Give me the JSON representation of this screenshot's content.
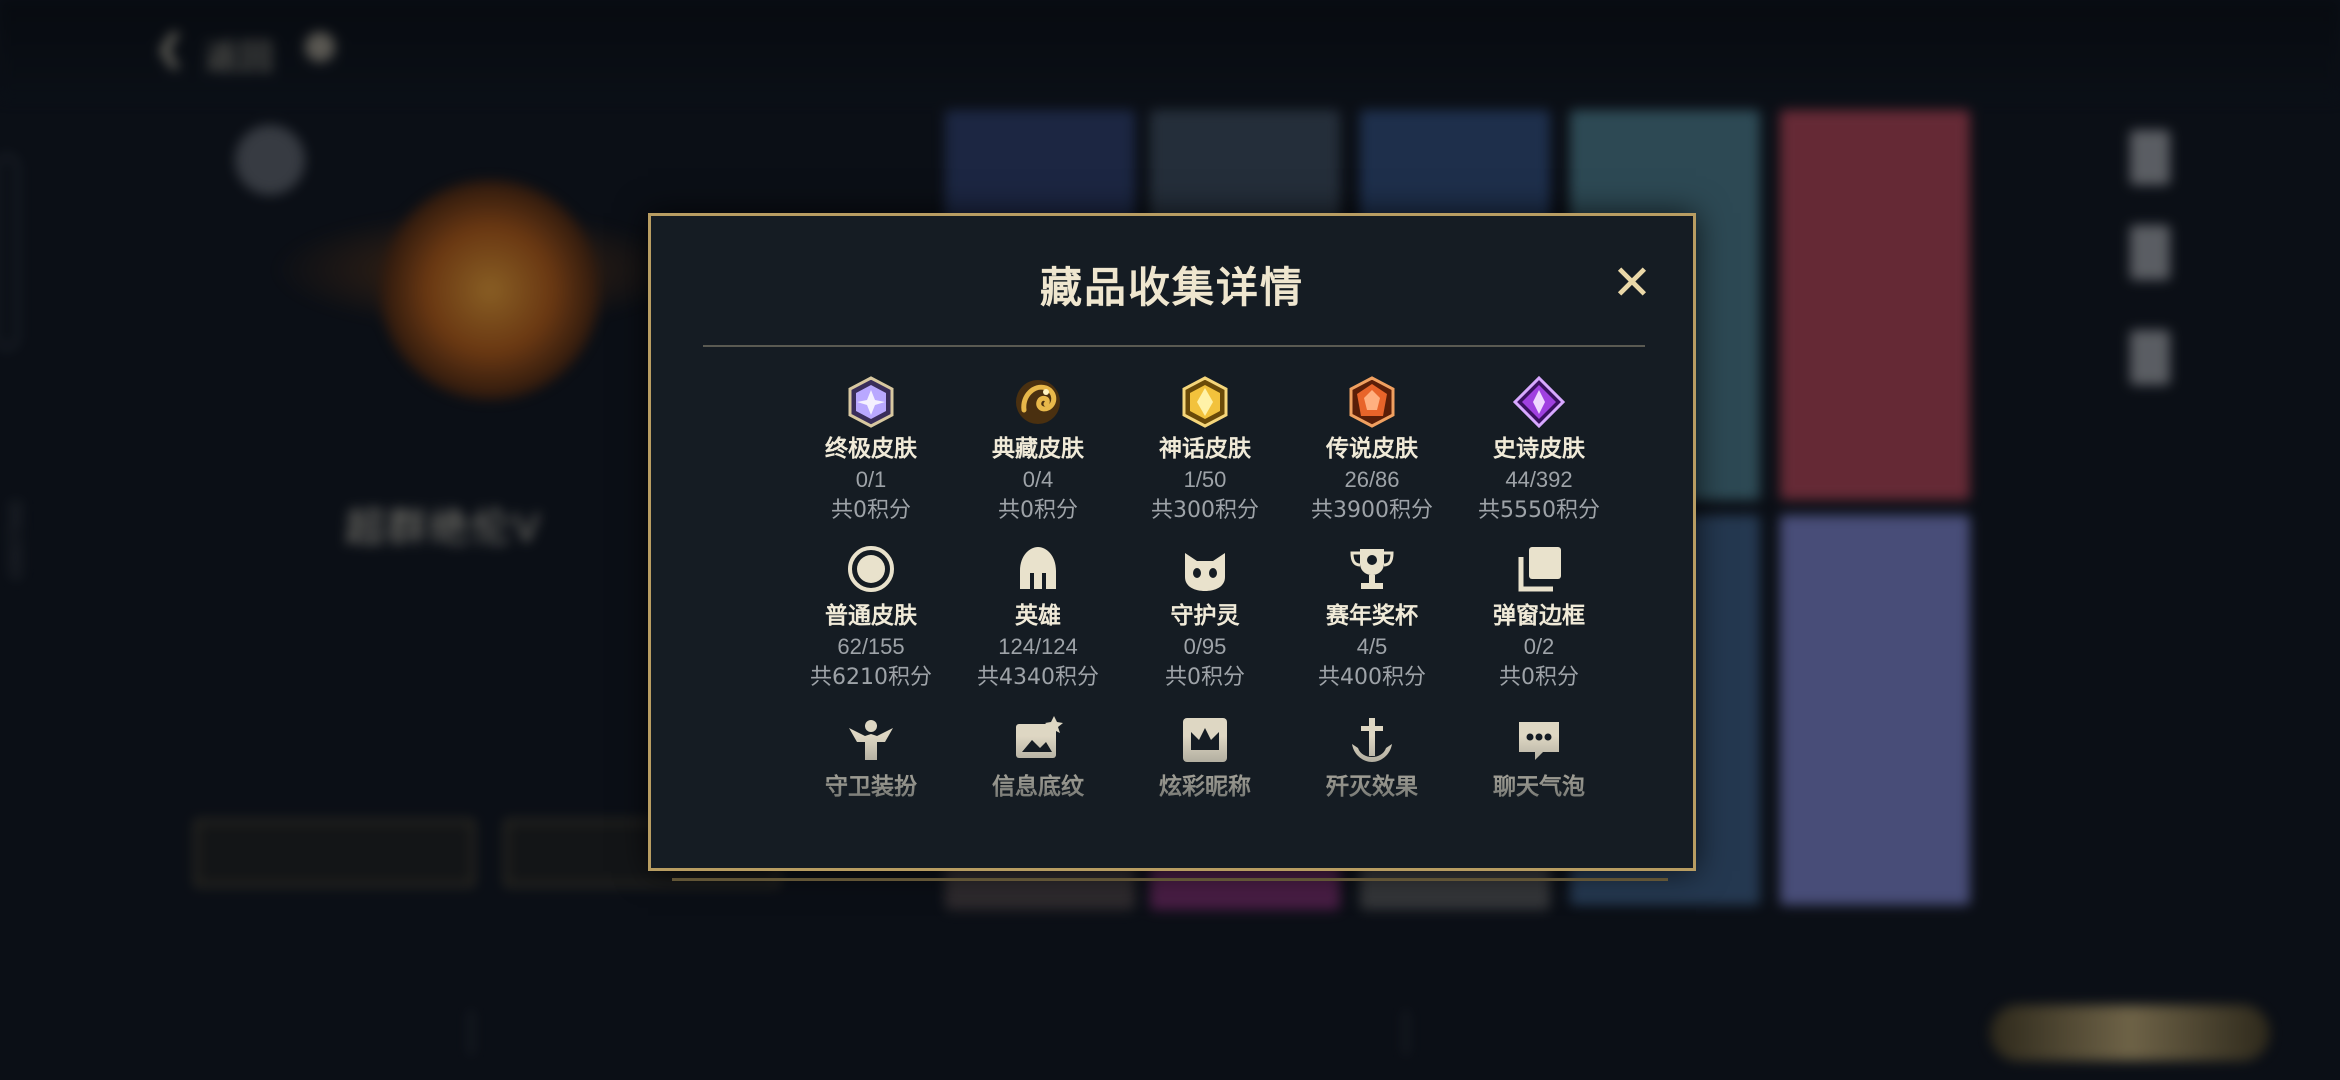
{
  "background": {
    "back_label": "返回",
    "player_name": "超群绝伦V",
    "player_sub": "",
    "side_id": "43937940",
    "bottom_tabs": [
      "",
      "",
      "",
      ""
    ]
  },
  "modal": {
    "title": "藏品收集详情",
    "close_icon": "close-icon",
    "rows": [
      [
        {
          "name": "终极皮肤",
          "count": "0/1",
          "points": "共0积分",
          "icon": "ultimate-skin-icon",
          "color": "#b9a8ff"
        },
        {
          "name": "典藏皮肤",
          "count": "0/4",
          "points": "共0积分",
          "icon": "dragon-emblem-icon",
          "color": "#e8b84a"
        },
        {
          "name": "神话皮肤",
          "count": "1/50",
          "points": "共300积分",
          "icon": "myth-skin-icon",
          "color": "#f2c23c"
        },
        {
          "name": "传说皮肤",
          "count": "26/86",
          "points": "共3900积分",
          "icon": "legend-skin-icon",
          "color": "#e8642a"
        },
        {
          "name": "史诗皮肤",
          "count": "44/392",
          "points": "共5550积分",
          "icon": "epic-skin-icon",
          "color": "#a040e0"
        }
      ],
      [
        {
          "name": "普通皮肤",
          "count": "62/155",
          "points": "共6210积分",
          "icon": "normal-skin-icon",
          "color": "#e9e2cc"
        },
        {
          "name": "英雄",
          "count": "124/124",
          "points": "共4340积分",
          "icon": "helmet-icon",
          "color": "#e9e2cc"
        },
        {
          "name": "守护灵",
          "count": "0/95",
          "points": "共0积分",
          "icon": "guardian-spirit-icon",
          "color": "#e9e2cc"
        },
        {
          "name": "赛年奖杯",
          "count": "4/5",
          "points": "共400积分",
          "icon": "trophy-icon",
          "color": "#e9e2cc"
        },
        {
          "name": "弹窗边框",
          "count": "0/2",
          "points": "共0积分",
          "icon": "frame-stack-icon",
          "color": "#e9e2cc"
        }
      ],
      [
        {
          "name": "守卫装扮",
          "icon": "guard-outfit-icon",
          "color": "#e9e2cc"
        },
        {
          "name": "信息底纹",
          "icon": "info-pattern-icon",
          "color": "#e9e2cc"
        },
        {
          "name": "炫彩昵称",
          "icon": "crown-card-icon",
          "color": "#e9e2cc"
        },
        {
          "name": "歼灭效果",
          "icon": "anchor-sword-icon",
          "color": "#e9e2cc"
        },
        {
          "name": "聊天气泡",
          "icon": "chat-bubble-icon",
          "color": "#e9e2cc"
        }
      ]
    ]
  }
}
